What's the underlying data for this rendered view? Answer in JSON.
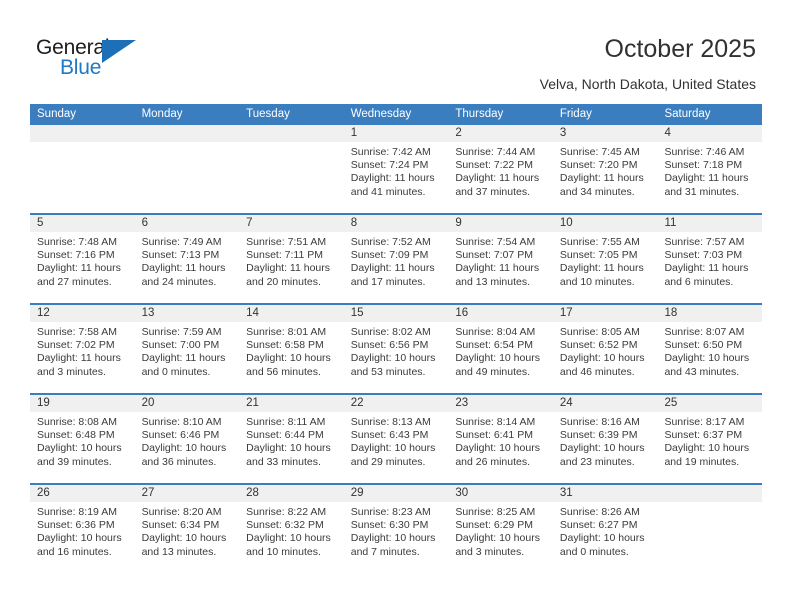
{
  "logo": {
    "word1": "General",
    "word2": "Blue",
    "triangle_color": "#1d70b8",
    "word2_color": "#2079c4"
  },
  "header": {
    "title": "October 2025",
    "subtitle": "Velva, North Dakota, United States"
  },
  "theme": {
    "header_blue": "#3a7ebf",
    "day_head_gray": "#f0f0f0",
    "text": "#3b3b3b"
  },
  "weekdays": [
    "Sunday",
    "Monday",
    "Tuesday",
    "Wednesday",
    "Thursday",
    "Friday",
    "Saturday"
  ],
  "weeks": [
    [
      {
        "day": "",
        "lines": []
      },
      {
        "day": "",
        "lines": []
      },
      {
        "day": "",
        "lines": []
      },
      {
        "day": "1",
        "lines": [
          "Sunrise: 7:42 AM",
          "Sunset: 7:24 PM",
          "Daylight: 11 hours",
          "and 41 minutes."
        ]
      },
      {
        "day": "2",
        "lines": [
          "Sunrise: 7:44 AM",
          "Sunset: 7:22 PM",
          "Daylight: 11 hours",
          "and 37 minutes."
        ]
      },
      {
        "day": "3",
        "lines": [
          "Sunrise: 7:45 AM",
          "Sunset: 7:20 PM",
          "Daylight: 11 hours",
          "and 34 minutes."
        ]
      },
      {
        "day": "4",
        "lines": [
          "Sunrise: 7:46 AM",
          "Sunset: 7:18 PM",
          "Daylight: 11 hours",
          "and 31 minutes."
        ]
      }
    ],
    [
      {
        "day": "5",
        "lines": [
          "Sunrise: 7:48 AM",
          "Sunset: 7:16 PM",
          "Daylight: 11 hours",
          "and 27 minutes."
        ]
      },
      {
        "day": "6",
        "lines": [
          "Sunrise: 7:49 AM",
          "Sunset: 7:13 PM",
          "Daylight: 11 hours",
          "and 24 minutes."
        ]
      },
      {
        "day": "7",
        "lines": [
          "Sunrise: 7:51 AM",
          "Sunset: 7:11 PM",
          "Daylight: 11 hours",
          "and 20 minutes."
        ]
      },
      {
        "day": "8",
        "lines": [
          "Sunrise: 7:52 AM",
          "Sunset: 7:09 PM",
          "Daylight: 11 hours",
          "and 17 minutes."
        ]
      },
      {
        "day": "9",
        "lines": [
          "Sunrise: 7:54 AM",
          "Sunset: 7:07 PM",
          "Daylight: 11 hours",
          "and 13 minutes."
        ]
      },
      {
        "day": "10",
        "lines": [
          "Sunrise: 7:55 AM",
          "Sunset: 7:05 PM",
          "Daylight: 11 hours",
          "and 10 minutes."
        ]
      },
      {
        "day": "11",
        "lines": [
          "Sunrise: 7:57 AM",
          "Sunset: 7:03 PM",
          "Daylight: 11 hours",
          "and 6 minutes."
        ]
      }
    ],
    [
      {
        "day": "12",
        "lines": [
          "Sunrise: 7:58 AM",
          "Sunset: 7:02 PM",
          "Daylight: 11 hours",
          "and 3 minutes."
        ]
      },
      {
        "day": "13",
        "lines": [
          "Sunrise: 7:59 AM",
          "Sunset: 7:00 PM",
          "Daylight: 11 hours",
          "and 0 minutes."
        ]
      },
      {
        "day": "14",
        "lines": [
          "Sunrise: 8:01 AM",
          "Sunset: 6:58 PM",
          "Daylight: 10 hours",
          "and 56 minutes."
        ]
      },
      {
        "day": "15",
        "lines": [
          "Sunrise: 8:02 AM",
          "Sunset: 6:56 PM",
          "Daylight: 10 hours",
          "and 53 minutes."
        ]
      },
      {
        "day": "16",
        "lines": [
          "Sunrise: 8:04 AM",
          "Sunset: 6:54 PM",
          "Daylight: 10 hours",
          "and 49 minutes."
        ]
      },
      {
        "day": "17",
        "lines": [
          "Sunrise: 8:05 AM",
          "Sunset: 6:52 PM",
          "Daylight: 10 hours",
          "and 46 minutes."
        ]
      },
      {
        "day": "18",
        "lines": [
          "Sunrise: 8:07 AM",
          "Sunset: 6:50 PM",
          "Daylight: 10 hours",
          "and 43 minutes."
        ]
      }
    ],
    [
      {
        "day": "19",
        "lines": [
          "Sunrise: 8:08 AM",
          "Sunset: 6:48 PM",
          "Daylight: 10 hours",
          "and 39 minutes."
        ]
      },
      {
        "day": "20",
        "lines": [
          "Sunrise: 8:10 AM",
          "Sunset: 6:46 PM",
          "Daylight: 10 hours",
          "and 36 minutes."
        ]
      },
      {
        "day": "21",
        "lines": [
          "Sunrise: 8:11 AM",
          "Sunset: 6:44 PM",
          "Daylight: 10 hours",
          "and 33 minutes."
        ]
      },
      {
        "day": "22",
        "lines": [
          "Sunrise: 8:13 AM",
          "Sunset: 6:43 PM",
          "Daylight: 10 hours",
          "and 29 minutes."
        ]
      },
      {
        "day": "23",
        "lines": [
          "Sunrise: 8:14 AM",
          "Sunset: 6:41 PM",
          "Daylight: 10 hours",
          "and 26 minutes."
        ]
      },
      {
        "day": "24",
        "lines": [
          "Sunrise: 8:16 AM",
          "Sunset: 6:39 PM",
          "Daylight: 10 hours",
          "and 23 minutes."
        ]
      },
      {
        "day": "25",
        "lines": [
          "Sunrise: 8:17 AM",
          "Sunset: 6:37 PM",
          "Daylight: 10 hours",
          "and 19 minutes."
        ]
      }
    ],
    [
      {
        "day": "26",
        "lines": [
          "Sunrise: 8:19 AM",
          "Sunset: 6:36 PM",
          "Daylight: 10 hours",
          "and 16 minutes."
        ]
      },
      {
        "day": "27",
        "lines": [
          "Sunrise: 8:20 AM",
          "Sunset: 6:34 PM",
          "Daylight: 10 hours",
          "and 13 minutes."
        ]
      },
      {
        "day": "28",
        "lines": [
          "Sunrise: 8:22 AM",
          "Sunset: 6:32 PM",
          "Daylight: 10 hours",
          "and 10 minutes."
        ]
      },
      {
        "day": "29",
        "lines": [
          "Sunrise: 8:23 AM",
          "Sunset: 6:30 PM",
          "Daylight: 10 hours",
          "and 7 minutes."
        ]
      },
      {
        "day": "30",
        "lines": [
          "Sunrise: 8:25 AM",
          "Sunset: 6:29 PM",
          "Daylight: 10 hours",
          "and 3 minutes."
        ]
      },
      {
        "day": "31",
        "lines": [
          "Sunrise: 8:26 AM",
          "Sunset: 6:27 PM",
          "Daylight: 10 hours",
          "and 0 minutes."
        ]
      },
      {
        "day": "",
        "lines": []
      }
    ]
  ]
}
